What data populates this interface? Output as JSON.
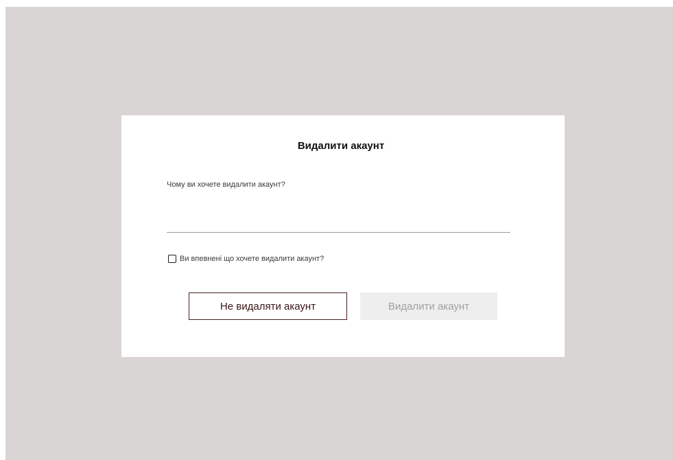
{
  "dialog": {
    "title": "Видалити акаунт",
    "reason_label": "Чому ви хочете видалити акаунт?",
    "reason_value": "",
    "confirm_label": "Ви впевнені що хочете видалити акаунт?",
    "confirm_checked": false,
    "cancel_button_label": "Не видаляти акаунт",
    "delete_button_label": "Видалити акаунт",
    "delete_button_state": "disabled"
  },
  "colors": {
    "backdrop": "#d9d5d4",
    "modal_background": "#ffffff",
    "cancel_border": "#4a1f1f",
    "disabled_button_bg": "#eeeeee",
    "disabled_button_text": "#a0a0a0"
  }
}
